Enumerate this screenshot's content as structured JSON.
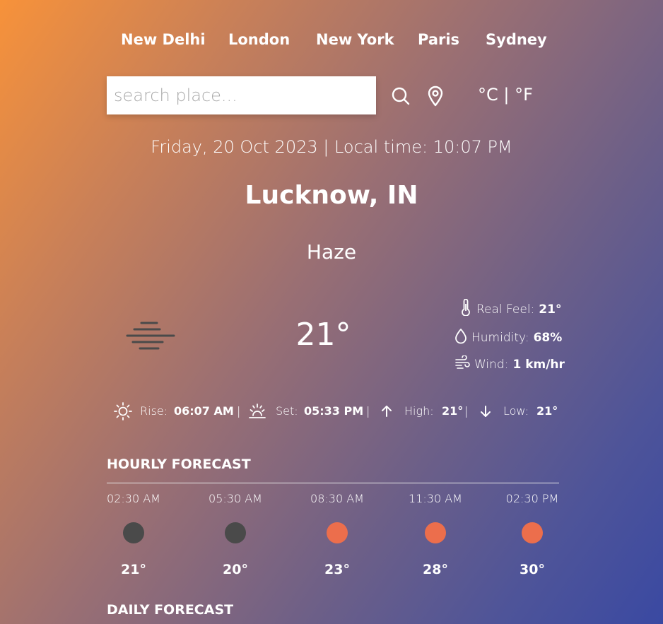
{
  "nav": {
    "cities": [
      "New Delhi",
      "London",
      "New York",
      "Paris",
      "Sydney"
    ]
  },
  "search": {
    "placeholder": "search place...",
    "search_icon": "search-icon",
    "location_icon": "map-pin-icon"
  },
  "units": {
    "celsius": "°C",
    "separator": "|",
    "fahrenheit": "°F"
  },
  "datetime": "Friday, 20 Oct 2023 | Local time: 10:07 PM",
  "location": "Lucknow, IN",
  "condition": "Haze",
  "current": {
    "icon": "haze-icon",
    "temperature": "21°",
    "real_feel_label": "Real Feel:",
    "real_feel_value": "21°",
    "humidity_label": "Humidity:",
    "humidity_value": "68%",
    "wind_label": "Wind:",
    "wind_value": "1 km/hr"
  },
  "sun": {
    "rise_label": "Rise:",
    "rise_value": "06:07 AM",
    "set_label": "Set:",
    "set_value": "05:33 PM",
    "high_label": "High:",
    "high_value": "21°",
    "low_label": "Low:",
    "low_value": "21°",
    "separator": "|"
  },
  "hourly": {
    "title": "HOURLY FORECAST",
    "items": [
      {
        "time": "02:30 AM",
        "temp": "21°",
        "icon": "moon-icon",
        "color": "#4a4a4a"
      },
      {
        "time": "05:30 AM",
        "temp": "20°",
        "icon": "moon-icon",
        "color": "#4a4a4a"
      },
      {
        "time": "08:30 AM",
        "temp": "23°",
        "icon": "sun-icon",
        "color": "#ec6e4c"
      },
      {
        "time": "11:30 AM",
        "temp": "28°",
        "icon": "sun-icon",
        "color": "#ec6e4c"
      },
      {
        "time": "02:30 PM",
        "temp": "30°",
        "icon": "sun-icon",
        "color": "#ec6e4c"
      }
    ]
  },
  "daily": {
    "title": "DAILY FORECAST"
  },
  "colors": {
    "gradient_start": "#f7923a",
    "gradient_end": "#3a49a2",
    "night_icon": "#4a4a4a",
    "day_icon": "#ec6e4c"
  }
}
